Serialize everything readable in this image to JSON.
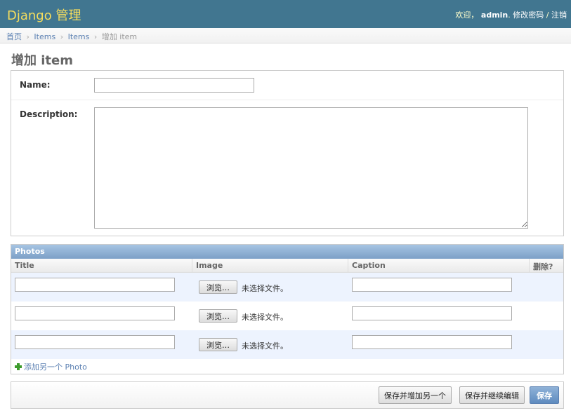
{
  "header": {
    "brand": "Django 管理",
    "welcome": "欢迎，",
    "username": "admin",
    "change_password": "修改密码",
    "separator": "/",
    "logout": "注销"
  },
  "breadcrumbs": {
    "home": "首页",
    "sep": "›",
    "app": "Items",
    "model": "Items",
    "current": "增加 item"
  },
  "page": {
    "title": "增加 item"
  },
  "form": {
    "name_label": "Name:",
    "name_value": "",
    "description_label": "Description:",
    "description_value": ""
  },
  "inline": {
    "title": "Photos",
    "columns": {
      "title": "Title",
      "image": "Image",
      "caption": "Caption",
      "delete": "删除?"
    },
    "browse_label": "浏览…",
    "no_file_text": "未选择文件。",
    "rows": [
      {
        "title": "",
        "caption": ""
      },
      {
        "title": "",
        "caption": ""
      },
      {
        "title": "",
        "caption": ""
      }
    ],
    "add_another": "添加另一个 Photo"
  },
  "submit": {
    "save_add_another": "保存并增加另一个",
    "save_continue": "保存并继续编辑",
    "save": "保存"
  }
}
